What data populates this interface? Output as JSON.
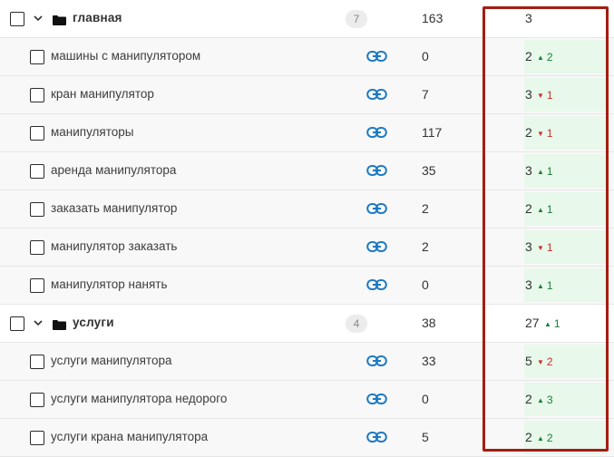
{
  "colors": {
    "accent_link": "#1e7ac3",
    "highlight": "#a31d12",
    "up": "#1a7f37",
    "down": "#c9302c",
    "position_bg": "#e8f8ea"
  },
  "rows": [
    {
      "type": "group",
      "name": "главная",
      "badge": "7",
      "count": "163",
      "position": "3",
      "delta": "",
      "dir": ""
    },
    {
      "type": "child",
      "name": "машины с манипулятором",
      "count": "0",
      "position": "2",
      "delta": "2",
      "dir": "up"
    },
    {
      "type": "child",
      "name": "кран манипулятор",
      "count": "7",
      "position": "3",
      "delta": "1",
      "dir": "down"
    },
    {
      "type": "child",
      "name": "манипуляторы",
      "count": "117",
      "position": "2",
      "delta": "1",
      "dir": "down"
    },
    {
      "type": "child",
      "name": "аренда манипулятора",
      "count": "35",
      "position": "3",
      "delta": "1",
      "dir": "up"
    },
    {
      "type": "child",
      "name": "заказать манипулятор",
      "count": "2",
      "position": "2",
      "delta": "1",
      "dir": "up"
    },
    {
      "type": "child",
      "name": "манипулятор заказать",
      "count": "2",
      "position": "3",
      "delta": "1",
      "dir": "down"
    },
    {
      "type": "child",
      "name": "манипулятор нанять",
      "count": "0",
      "position": "3",
      "delta": "1",
      "dir": "up"
    },
    {
      "type": "group",
      "name": "услуги",
      "badge": "4",
      "count": "38",
      "position": "27",
      "delta": "1",
      "dir": "up"
    },
    {
      "type": "child",
      "name": "услуги манипулятора",
      "count": "33",
      "position": "5",
      "delta": "2",
      "dir": "down"
    },
    {
      "type": "child",
      "name": "услуги манипулятора недорого",
      "count": "0",
      "position": "2",
      "delta": "3",
      "dir": "up"
    },
    {
      "type": "child",
      "name": "услуги крана манипулятора",
      "count": "5",
      "position": "2",
      "delta": "2",
      "dir": "up"
    }
  ],
  "icons": {
    "checkbox": "checkbox-icon",
    "chevron": "chevron-down-icon",
    "folder": "folder-icon",
    "link": "link-icon",
    "up": "arrow-up-icon",
    "down": "arrow-down-icon"
  }
}
